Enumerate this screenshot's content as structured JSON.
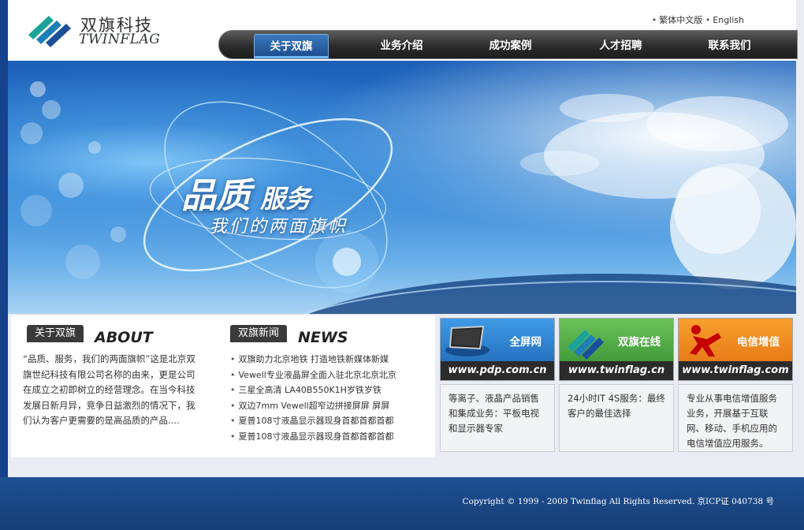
{
  "header": {
    "logo_cn": "双旗科技",
    "logo_en": "TWINFLAG",
    "lang_links": [
      "繁体中文版",
      "English"
    ]
  },
  "nav": {
    "items": [
      "关于双旗",
      "业务介绍",
      "成功案例",
      "人才招聘",
      "联系我们"
    ],
    "active_index": 0
  },
  "banner": {
    "title_main": "品质",
    "title_small": "服务",
    "subtitle": "我们的两面旗帜"
  },
  "about": {
    "tab": "关于双旗",
    "heading": "ABOUT",
    "text": "“品质、服务，我们的两面旗帜”这是北京双旗世纪科技有限公司名称的由来，更是公司在成立之初即树立的经营理念。在当今科技发展日新月异，竞争日益激烈的情况下，我们认为客户更需要的是高品质的产品...."
  },
  "news": {
    "tab": "双旗新闻",
    "heading": "NEWS",
    "items": [
      "双旗助力北京地铁 打造地铁新媒体新媒",
      "Vewell专业液晶屏全面入驻北京北京北京",
      "三星全高清 LA40B550K1H岁铁岁铁",
      "双边7mm Vewell超窄边拼接屏屏 屏屏",
      "夏普108寸液晶显示器现身首都首都首都",
      "夏普108寸液晶显示器现身首都首都首都"
    ]
  },
  "cards": [
    {
      "name": "全屏网",
      "url": "www.pdp.com.cn",
      "desc": "等离子、液晶产品销售和集成业务：平板电视和显示器专家",
      "color": "#2a7fd0"
    },
    {
      "name": "双旗在线",
      "url": "www.twinflag.cn",
      "desc": "24小时IT 4S服务：最终客户的最佳选择",
      "color": "#4caa3a"
    },
    {
      "name": "电信增值",
      "url": "www.twinflag.com",
      "desc": "专业从事电信增值服务业务，开展基于互联网、移动、手机应用的电信增值应用服务。",
      "color": "#f07d1c"
    }
  ],
  "footer": {
    "copyright": "Copyright © 1999 - 2009 Twinflag All Rights Reserved. 京ICP证 040738 号"
  }
}
